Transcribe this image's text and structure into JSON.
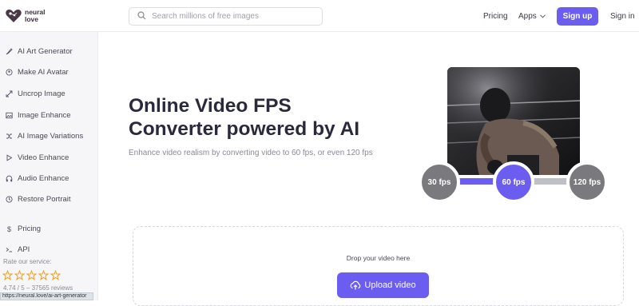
{
  "brand": {
    "name": "neural love",
    "accent": "#6b5df0"
  },
  "header": {
    "search_placeholder": "Search millions of free images",
    "pricing": "Pricing",
    "apps": "Apps",
    "signup": "Sign up",
    "signin": "Sign in"
  },
  "sidebar": {
    "items": [
      {
        "label": "AI Art Generator",
        "icon": "brush-icon"
      },
      {
        "label": "Make AI Avatar",
        "icon": "avatar-icon"
      },
      {
        "label": "Uncrop Image",
        "icon": "expand-icon"
      },
      {
        "label": "Image Enhance",
        "icon": "image-icon"
      },
      {
        "label": "AI Image Variations",
        "icon": "shuffle-icon"
      },
      {
        "label": "Video Enhance",
        "icon": "play-icon"
      },
      {
        "label": "Audio Enhance",
        "icon": "headphones-icon"
      },
      {
        "label": "Restore Portrait",
        "icon": "portrait-icon"
      }
    ],
    "pricing": "Pricing",
    "api": "API",
    "rate_label": "Rate our service:",
    "reviews": "4.74 / 5 – 37565 reviews",
    "status_url": "https://neural.love/ai-art-generator"
  },
  "hero": {
    "title_line1": "Online Video FPS",
    "title_line2": "Converter powered by AI",
    "subtitle": "Enhance video realism by converting video to 60 fps, or even 120 fps"
  },
  "fps": {
    "option1": "30 fps",
    "option2": "60 fps",
    "option3": "120 fps",
    "selected": "60 fps"
  },
  "upload": {
    "drop_text": "Drop your video here",
    "button": "Upload video"
  }
}
